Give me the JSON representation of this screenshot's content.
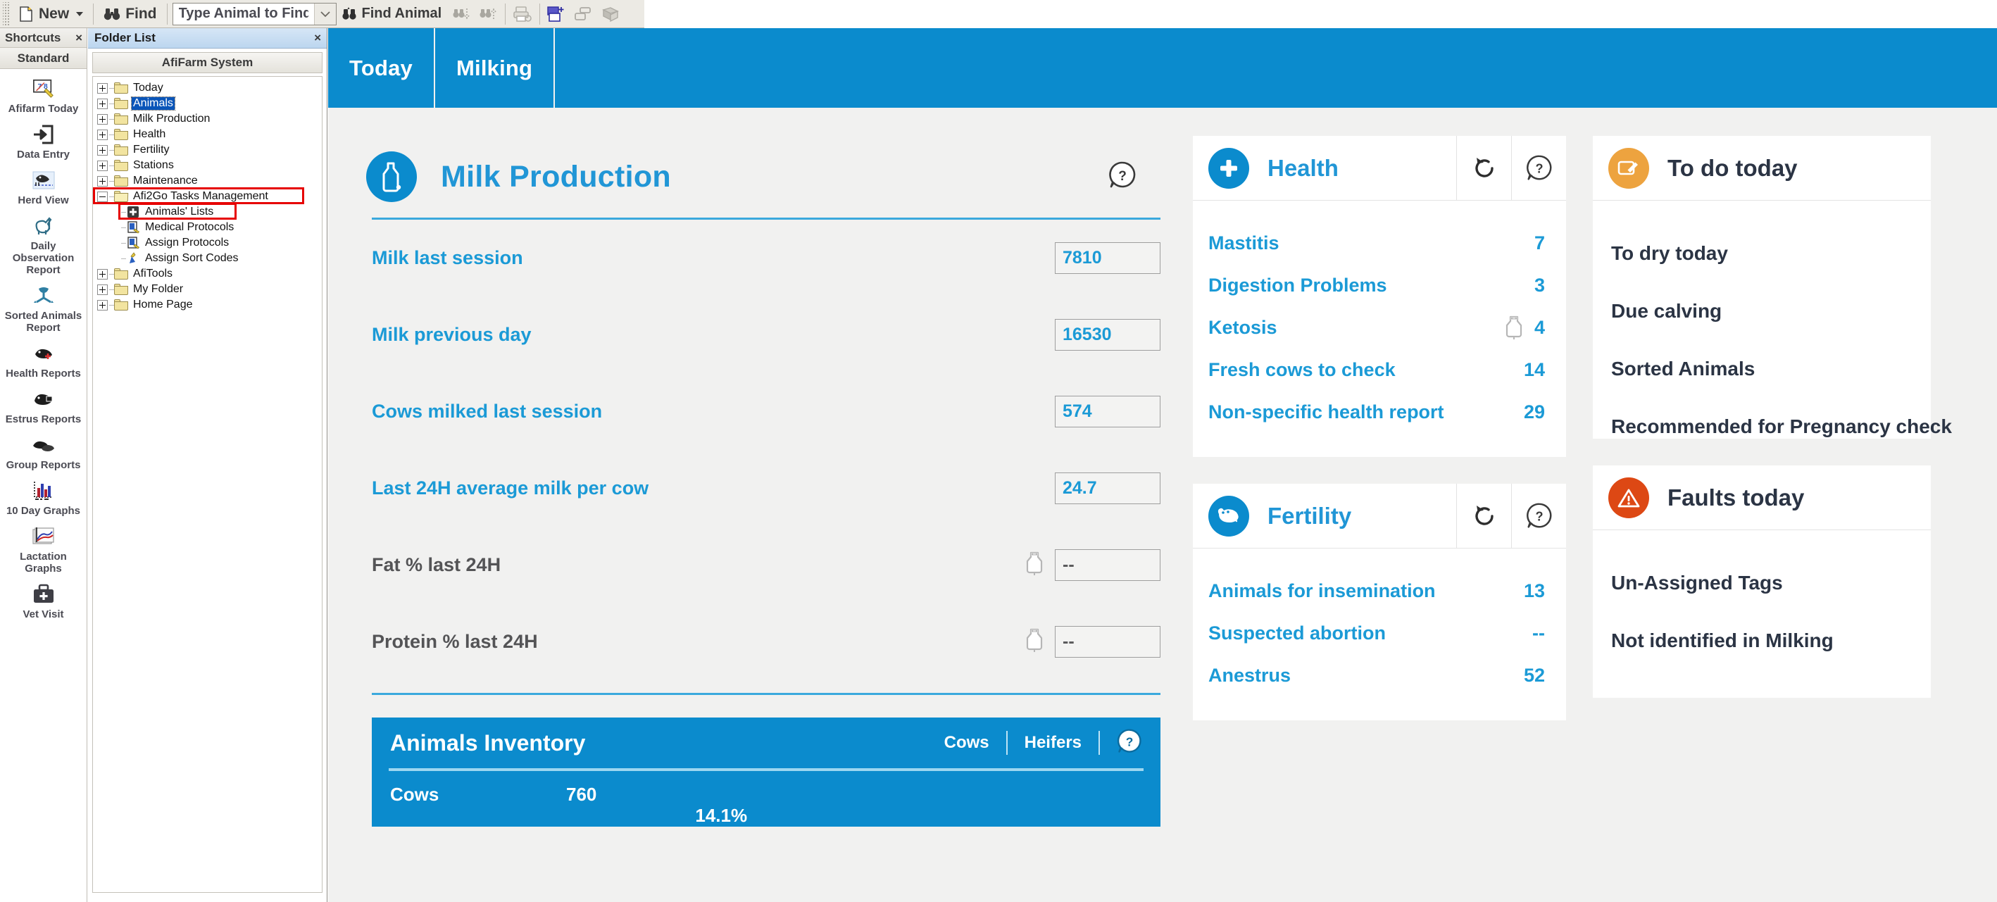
{
  "toolbar": {
    "new_label": "New",
    "find_label": "Find",
    "search_placeholder": "Type Animal to Find",
    "search_value": "",
    "find_animal_label": "Find Animal",
    "icons": {
      "new": "new-document-icon",
      "find": "binoculars-icon",
      "combo": "chevron-down-icon",
      "find_animal": "find-animal-icon",
      "find_next": "find-next-icon",
      "find_prev": "find-previous-icon",
      "print": "print-icon",
      "window_new": "new-window-icon",
      "window_tile": "tile-windows-icon",
      "book": "book-icon"
    }
  },
  "shortcuts": {
    "title": "Shortcuts",
    "close": "×",
    "group": "Standard",
    "items": [
      {
        "label": "Afifarm Today",
        "icon": "afifarm-today-icon"
      },
      {
        "label": "Data Entry",
        "icon": "data-entry-icon"
      },
      {
        "label": "Herd View",
        "icon": "herd-view-icon"
      },
      {
        "label": "Daily Observation Report",
        "icon": "daily-observation-report-icon"
      },
      {
        "label": "Sorted Animals Report",
        "icon": "sorted-animals-report-icon"
      },
      {
        "label": "Health Reports",
        "icon": "health-reports-icon"
      },
      {
        "label": "Estrus Reports",
        "icon": "estrus-reports-icon"
      },
      {
        "label": "Group Reports",
        "icon": "group-reports-icon"
      },
      {
        "label": "10 Day Graphs",
        "icon": "ten-day-graphs-icon"
      },
      {
        "label": "Lactation Graphs",
        "icon": "lactation-graphs-icon"
      },
      {
        "label": "Vet Visit",
        "icon": "vet-visit-icon"
      }
    ]
  },
  "folder_list": {
    "title": "Folder List",
    "close": "×",
    "system_label": "AfiFarm System",
    "nodes": [
      {
        "label": "Today",
        "level": 1,
        "state": "collapsed",
        "selected": false,
        "highlighted": false
      },
      {
        "label": "Animals",
        "level": 1,
        "state": "collapsed",
        "selected": true,
        "highlighted": false
      },
      {
        "label": "Milk Production",
        "level": 1,
        "state": "collapsed",
        "selected": false,
        "highlighted": false
      },
      {
        "label": "Health",
        "level": 1,
        "state": "collapsed",
        "selected": false,
        "highlighted": false
      },
      {
        "label": "Fertility",
        "level": 1,
        "state": "collapsed",
        "selected": false,
        "highlighted": false
      },
      {
        "label": "Stations",
        "level": 1,
        "state": "collapsed",
        "selected": false,
        "highlighted": false
      },
      {
        "label": "Maintenance",
        "level": 1,
        "state": "collapsed",
        "selected": false,
        "highlighted": false
      },
      {
        "label": "Afi2Go Tasks Management",
        "level": 1,
        "state": "expanded",
        "selected": false,
        "highlighted": true
      },
      {
        "label": "Animals' Lists",
        "level": 2,
        "state": "leaf",
        "icon": "animals-lists-icon",
        "selected": false,
        "highlighted": true
      },
      {
        "label": "Medical Protocols",
        "level": 2,
        "state": "leaf",
        "icon": "medical-protocols-icon",
        "selected": false,
        "highlighted": false
      },
      {
        "label": "Assign Protocols",
        "level": 2,
        "state": "leaf",
        "icon": "assign-protocols-icon",
        "selected": false,
        "highlighted": false
      },
      {
        "label": "Assign Sort Codes",
        "level": 2,
        "state": "leaf",
        "icon": "assign-sort-codes-icon",
        "selected": false,
        "highlighted": false
      },
      {
        "label": "AfiTools",
        "level": 1,
        "state": "collapsed",
        "selected": false,
        "highlighted": false
      },
      {
        "label": "My Folder",
        "level": 1,
        "state": "collapsed",
        "selected": false,
        "highlighted": false
      },
      {
        "label": "Home Page",
        "level": 1,
        "state": "collapsed",
        "selected": false,
        "highlighted": false
      }
    ]
  },
  "tabs": [
    {
      "label": "Today",
      "active": true
    },
    {
      "label": "Milking",
      "active": false
    }
  ],
  "milk_production": {
    "title": "Milk Production",
    "icon": "milk-bottle-icon",
    "help_icon": "help-icon",
    "rows": [
      {
        "label": "Milk last session",
        "value": "7810",
        "muted": false,
        "has_bottle_icon": false
      },
      {
        "label": "Milk previous day",
        "value": "16530",
        "muted": false,
        "has_bottle_icon": false
      },
      {
        "label": "Cows milked last session",
        "value": "574",
        "muted": false,
        "has_bottle_icon": false
      },
      {
        "label": "Last 24H average milk per cow",
        "value": "24.7",
        "muted": false,
        "has_bottle_icon": false
      },
      {
        "label": "Fat % last 24H",
        "value": "--",
        "muted": true,
        "has_bottle_icon": true
      },
      {
        "label": "Protein % last 24H",
        "value": "--",
        "muted": true,
        "has_bottle_icon": true
      }
    ]
  },
  "animals_inventory": {
    "title": "Animals Inventory",
    "toggles": [
      "Cows",
      "Heifers"
    ],
    "help_icon": "help-icon",
    "rows": [
      {
        "label": "Cows",
        "value": "760",
        "percent": "14.1%"
      }
    ]
  },
  "health_card": {
    "title": "Health",
    "icon": "health-plus-icon",
    "refresh_icon": "refresh-icon",
    "help_icon": "help-icon",
    "rows": [
      {
        "label": "Mastitis",
        "value": "7",
        "has_bottle_icon": false
      },
      {
        "label": "Digestion Problems",
        "value": "3",
        "has_bottle_icon": false
      },
      {
        "label": "Ketosis",
        "value": "4",
        "has_bottle_icon": true
      },
      {
        "label": "Fresh cows to check",
        "value": "14",
        "has_bottle_icon": false
      },
      {
        "label": "Non-specific health report",
        "value": "29",
        "has_bottle_icon": false
      }
    ]
  },
  "fertility_card": {
    "title": "Fertility",
    "icon": "cow-icon",
    "refresh_icon": "refresh-icon",
    "help_icon": "help-icon",
    "rows": [
      {
        "label": "Animals for insemination",
        "value": "13",
        "has_bottle_icon": false
      },
      {
        "label": "Suspected abortion",
        "value": "--",
        "has_bottle_icon": false
      },
      {
        "label": "Anestrus",
        "value": "52",
        "has_bottle_icon": false
      }
    ]
  },
  "todo_card": {
    "title": "To do today",
    "icon": "note-edit-icon",
    "rows": [
      {
        "label": "To dry today"
      },
      {
        "label": "Due calving"
      },
      {
        "label": "Sorted Animals"
      },
      {
        "label": "Recommended for Pregnancy check"
      }
    ]
  },
  "faults_card": {
    "title": "Faults today",
    "icon": "warning-triangle-icon",
    "rows": [
      {
        "label": "Un-Assigned Tags"
      },
      {
        "label": "Not identified in Milking"
      }
    ]
  },
  "colors": {
    "accent_blue": "#0b8bcd",
    "link_blue": "#1b9ad6",
    "orange": "#eda33f",
    "red": "#dd4814",
    "tree_select": "#0a55b9",
    "highlight_red": "#e60000"
  }
}
